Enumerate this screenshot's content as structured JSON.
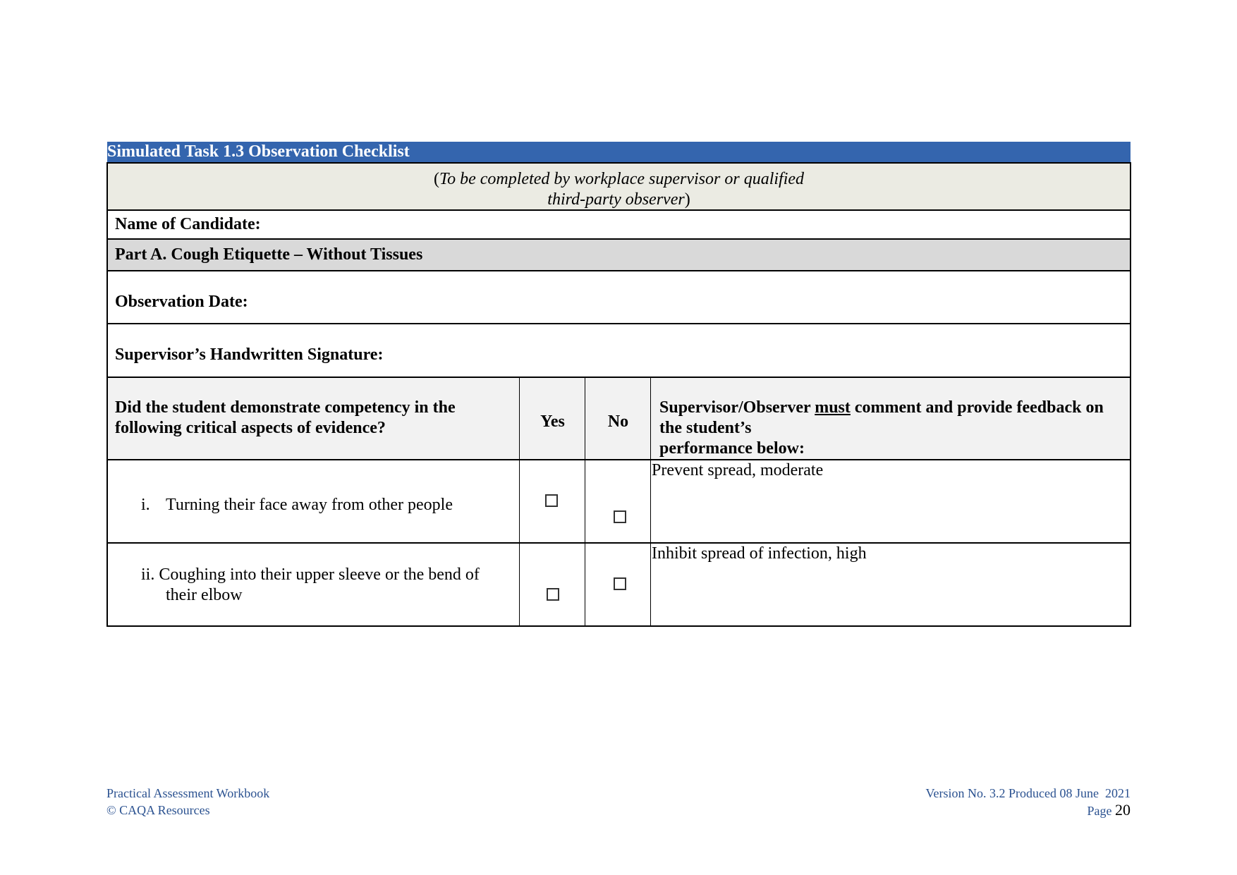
{
  "document": {
    "title": "Simulated Task 1.3 Observation Checklist",
    "instructions": {
      "open_paren": "(",
      "line1": "To be completed by workplace supervisor or qualified",
      "line2": "third-party observer",
      "close_paren": ")"
    },
    "fields": {
      "candidate_name_label": "Name of Candidate:",
      "candidate_name_value": "",
      "part_title": "Part A. Cough Etiquette – Without Tissues",
      "observation_date_label": "Observation Date:",
      "observation_date_value": "",
      "signature_label": "Supervisor’s Handwritten Signature:",
      "signature_value": ""
    },
    "table": {
      "headers": {
        "question_line1": "Did the student demonstrate competency in the",
        "question_line2": "following critical aspects of evidence?",
        "yes": "Yes",
        "no": "No",
        "feedback_pre": "Supervisor/Observer ",
        "feedback_emph": "must",
        "feedback_post": " comment and provide feedback on",
        "feedback_line2": "the student’s",
        "feedback_line3": "performance below:"
      },
      "rows": [
        {
          "numeral": "i.",
          "criterion_line1": "Turning their face away from other people",
          "criterion_line2": "",
          "yes_checked": false,
          "no_checked": false,
          "feedback": "Prevent spread, moderate"
        },
        {
          "numeral": "ii.",
          "criterion_line1": "Coughing into their upper sleeve or the bend of",
          "criterion_line2": "their elbow",
          "yes_checked": false,
          "no_checked": false,
          "feedback": "Inhibit spread of infection, high"
        }
      ],
      "checkbox_glyph": "☐"
    },
    "footer": {
      "left_line1": "Practical Assessment Workbook",
      "left_line2": "© CAQA Resources",
      "right_line1": "Version No. 3.2 Produced 08 June  2021",
      "page_label": "Page",
      "page_number": "20"
    },
    "colors": {
      "title_bar": "#3465ae",
      "instructions_bg": "#ebebe3",
      "part_bg": "#d9d9d9",
      "header_bg": "#f2f2f2",
      "footer_text": "#2a5190"
    }
  }
}
